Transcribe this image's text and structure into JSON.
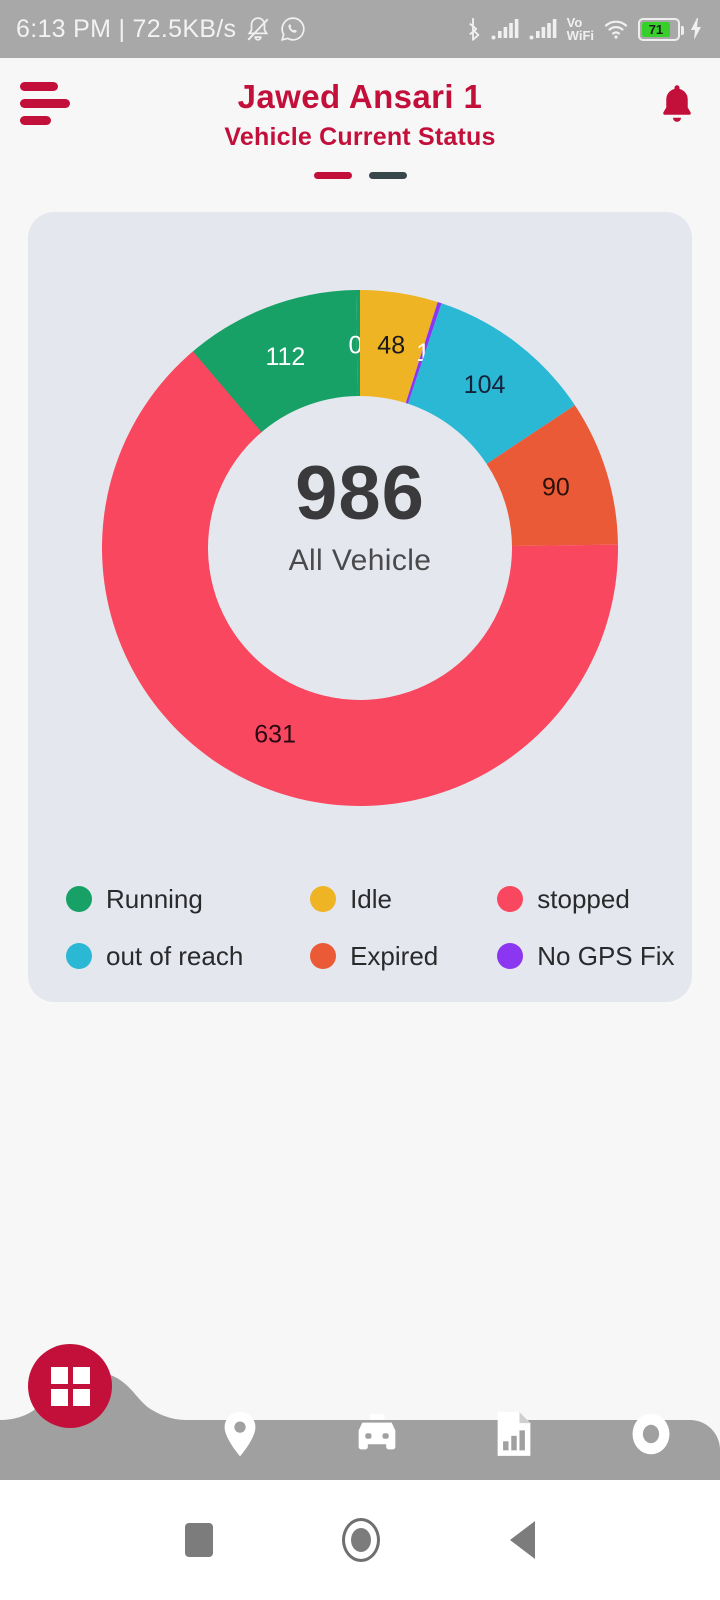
{
  "status_bar": {
    "time_and_data": "6:13 PM | 72.5KB/s",
    "silent_icon": "bell-muted-icon",
    "whatsapp_icon": "whatsapp-icon",
    "bluetooth_icon": "bluetooth-icon",
    "signal1_icon": "signal-bars-icon",
    "signal2_icon": "signal-bars-icon",
    "volte_label_top": "Vo",
    "volte_label_bottom": "WiFi",
    "wifi_icon": "wifi-icon",
    "battery_percent": "71",
    "battery_level": 71,
    "charging_icon": "charging-bolt-icon"
  },
  "app_bar": {
    "menu_icon": "hamburger-menu-icon",
    "title": "Jawed Ansari 1",
    "subtitle": "Vehicle Current Status",
    "notification_icon": "bell-icon",
    "accent_color": "#c3103a",
    "page_indicator": [
      {
        "state": "active",
        "color": "#c3103a"
      },
      {
        "state": "inactive",
        "color": "#37474b"
      }
    ]
  },
  "chart_data": {
    "type": "pie",
    "title": "Vehicle Current Status",
    "center_value": "986",
    "center_label": "All Vehicle",
    "total": 986,
    "categories": [
      "Running",
      "No GPS Fix",
      "Idle",
      "Expired",
      "out of reach",
      "Expired",
      "stopped"
    ],
    "labels": [
      "112",
      "0",
      "48",
      "1",
      "104",
      "90",
      "631"
    ],
    "values": [
      112,
      0,
      48,
      1,
      104,
      90,
      631
    ],
    "legend_position": "bottom",
    "slices": [
      {
        "label": "112",
        "value": 112,
        "color": "#17a167",
        "name": "Running",
        "text_color": "#ffffff"
      },
      {
        "label": "0",
        "value": 0,
        "color": "#17a167",
        "name": "zero-slice",
        "text_color": "#ffffff"
      },
      {
        "label": "48",
        "value": 48,
        "color": "#eeb424",
        "name": "Idle",
        "text_color": "#1a1a1a"
      },
      {
        "label": "1",
        "value": 1,
        "color": "#8b36f0",
        "name": "No GPS Fix",
        "text_color": "#ffffff"
      },
      {
        "label": "104",
        "value": 104,
        "color": "#2bb8d4",
        "name": "out of reach",
        "text_color": "#16213a"
      },
      {
        "label": "90",
        "value": 90,
        "color": "#eb5a36",
        "name": "Expired",
        "text_color": "#2a1008"
      },
      {
        "label": "631",
        "value": 631,
        "color": "#f9475f",
        "name": "stopped",
        "text_color": "#2a0a12"
      }
    ]
  },
  "legend": {
    "rows": [
      [
        {
          "label": "Running",
          "color": "#17a167"
        },
        {
          "label": "Idle",
          "color": "#eeb424"
        },
        {
          "label": "stopped",
          "color": "#f9475f"
        }
      ],
      [
        {
          "label": "out of reach",
          "color": "#2bb8d4"
        },
        {
          "label": "Expired",
          "color": "#eb5a36"
        },
        {
          "label": "No GPS Fix",
          "color": "#8b36f0"
        }
      ]
    ]
  },
  "bottom_nav": {
    "fab_icon": "dashboard-grid-icon",
    "items": [
      {
        "icon": "location-pin-icon"
      },
      {
        "icon": "car-icon"
      },
      {
        "icon": "report-chart-icon"
      },
      {
        "icon": "circle-icon"
      }
    ]
  },
  "android_nav": {
    "recents_icon": "square-recents-icon",
    "home_icon": "circle-home-icon",
    "back_icon": "triangle-back-icon"
  }
}
